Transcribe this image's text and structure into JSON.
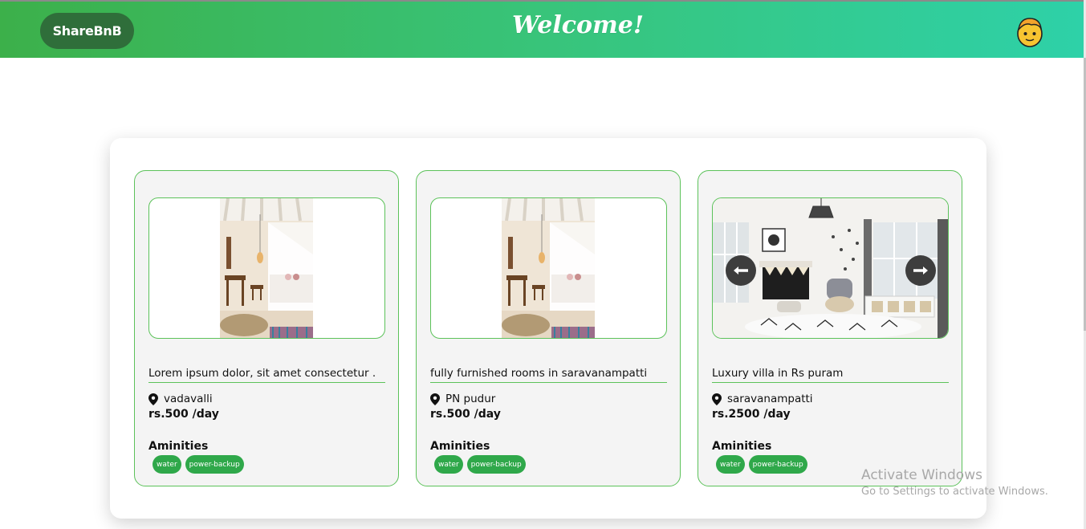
{
  "navbar": {
    "brand": "ShareBnB",
    "welcome": "Welcome!",
    "avatar_icon": "boy-face-emoji-icon",
    "gradient": [
      "#3cb04a",
      "#2ed1a8"
    ],
    "brand_color": "#2f6e3a"
  },
  "cards": [
    {
      "title": "Lorem ipsum dolor, sit amet consectetur .",
      "location": "vadavalli",
      "price": "rs.500 /day",
      "amenities_title": "Aminities",
      "amenities": [
        "water",
        "power-backup"
      ],
      "image": "bedroom-canopy-photo"
    },
    {
      "title": "fully furnished rooms in saravanampatti",
      "location": "PN pudur",
      "price": "rs.500 /day",
      "amenities_title": "Aminities",
      "amenities": [
        "water",
        "power-backup"
      ],
      "image": "bedroom-canopy-photo"
    },
    {
      "title": "Luxury villa in Rs puram",
      "location": "saravanampatti",
      "price": "rs.2500 /day",
      "amenities_title": "Aminities",
      "amenities": [
        "water",
        "power-backup"
      ],
      "image": "kids-room-photo",
      "carousel_icons": [
        "arrow-left-icon",
        "arrow-right-icon"
      ]
    }
  ],
  "accent_color": "#2fa84a",
  "watermark": {
    "title": "Activate Windows",
    "subtitle": "Go to Settings to activate Windows."
  }
}
